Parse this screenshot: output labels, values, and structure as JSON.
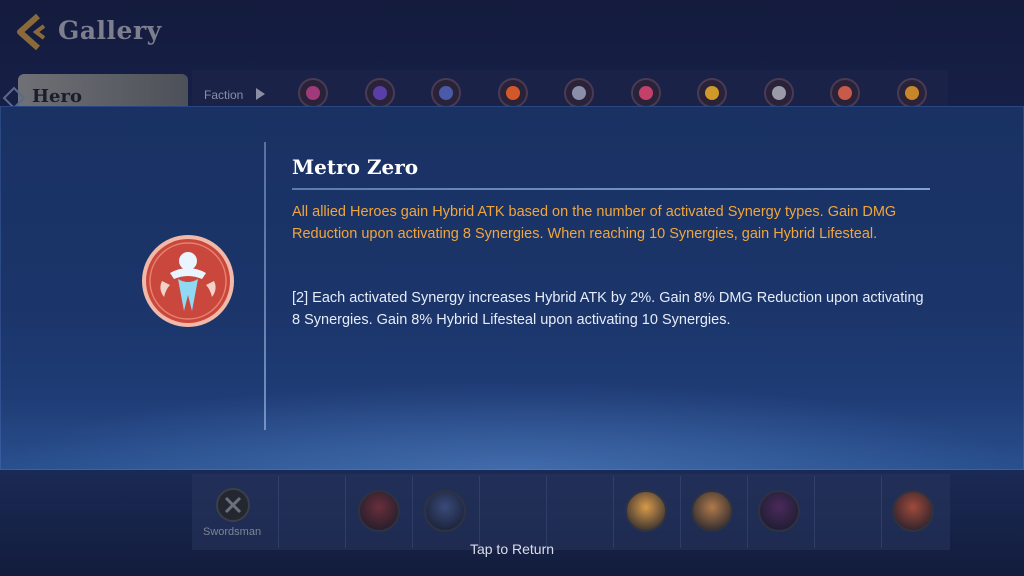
{
  "header": {
    "title": "Gallery",
    "active_tab": "Hero"
  },
  "filters": {
    "faction_label": "Faction",
    "faction_icons": [
      {
        "name": "faction-icon-1",
        "color": "#a03a7a"
      },
      {
        "name": "faction-icon-2",
        "color": "#5a3ea8"
      },
      {
        "name": "faction-icon-3",
        "color": "#4a5aa8"
      },
      {
        "name": "faction-icon-4",
        "color": "#d2582a"
      },
      {
        "name": "faction-icon-5",
        "color": "#8a8ea8"
      },
      {
        "name": "faction-icon-6",
        "color": "#c2406a"
      },
      {
        "name": "faction-icon-7",
        "color": "#d09a2a"
      },
      {
        "name": "faction-icon-8",
        "color": "#9a9aa8"
      },
      {
        "name": "faction-icon-9",
        "color": "#c85a4a"
      },
      {
        "name": "faction-icon-10",
        "color": "#c8862a"
      }
    ]
  },
  "synergy": {
    "name": "Metro Zero",
    "description": "All allied Heroes gain Hybrid ATK based on the number of activated Synergy types. Gain DMG Reduction upon activating 8 Synergies. When reaching 10 Synergies, gain Hybrid Lifesteal.",
    "tier_text": "[2] Each activated Synergy increases Hybrid ATK by 2%. Gain 8% DMG Reduction upon activating 8 Synergies. Gain 8% Hybrid Lifesteal upon activating 10 Synergies.",
    "description_color": "#f0a63c",
    "emblem_color": "#c9473c"
  },
  "roster": {
    "class_label": "Swordsman",
    "portraits": [
      {
        "name": "hero-portrait-1",
        "color": "#6a2e3a"
      },
      {
        "name": "hero-portrait-2",
        "color": "#3a4a7a"
      },
      {
        "name": "hero-portrait-3",
        "color": "#d89a4a"
      },
      {
        "name": "hero-portrait-4",
        "color": "#b07a4a"
      },
      {
        "name": "hero-portrait-5",
        "color": "#4a2a5a"
      },
      {
        "name": "hero-portrait-6",
        "color": "#a04a3a"
      }
    ]
  },
  "footer": {
    "tap_to_return": "Tap to Return"
  }
}
